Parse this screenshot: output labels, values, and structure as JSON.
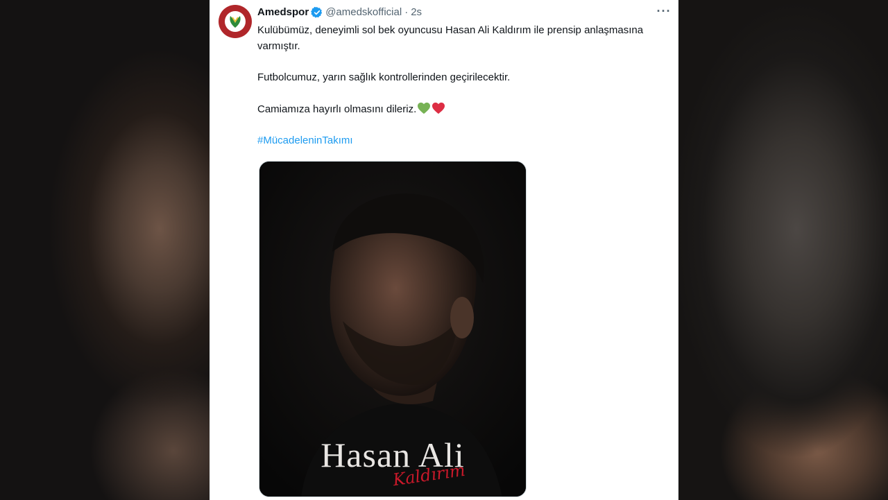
{
  "tweet": {
    "display_name": "Amedspor",
    "handle": "@amedskofficial",
    "separator": "·",
    "time": "2s",
    "more_label": "···",
    "paragraph_1": "Kulübümüz, deneyimli sol bek oyuncusu Hasan Ali Kaldırım ile prensip anlaşmasına varmıştır.",
    "paragraph_2": "Futbolcumuz, yarın sağlık kontrollerinden geçirilecektir.",
    "paragraph_3": "Camiamıza hayırlı olmasını dileriz.",
    "hashtag": "#MücadeleninTakımı",
    "emoji": [
      "green-heart-icon",
      "red-heart-icon"
    ]
  },
  "media": {
    "name_text": "Hasan Ali",
    "script_text": "Kaldırım"
  },
  "colors": {
    "link": "#1d9bf0",
    "verified": "#1d9bf0",
    "club_red": "#b0262a",
    "club_green": "#2e8b3a"
  }
}
